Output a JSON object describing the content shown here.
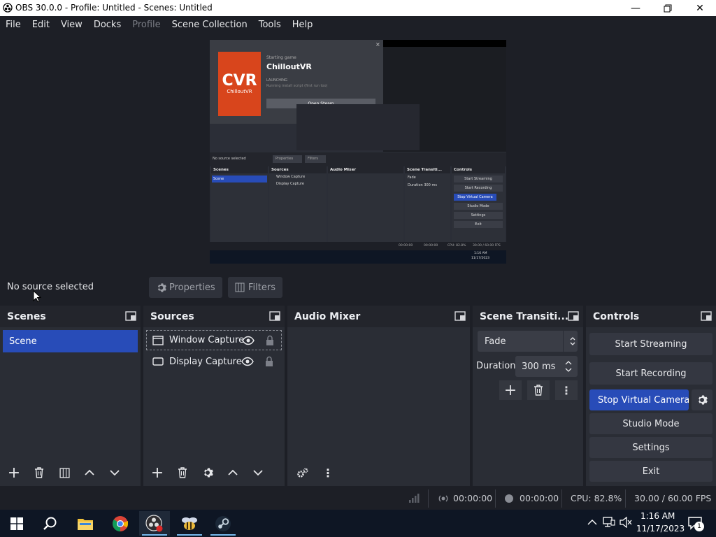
{
  "window": {
    "title": "OBS 30.0.0 - Profile: Untitled - Scenes: Untitled"
  },
  "menu": [
    "File",
    "Edit",
    "View",
    "Docks",
    "Profile",
    "Scene Collection",
    "Tools",
    "Help"
  ],
  "preview": {
    "game_status": "Starting game",
    "game_title": "ChilloutVR",
    "logo_text": "ChilloutVR",
    "launching": "LAUNCHING",
    "launch_note": "Running install script (first run too)",
    "open_steam": "Open Steam",
    "nested_no_source": "No source selected",
    "nested_properties": "Properties",
    "nested_filters": "Filters",
    "nested_docks": [
      "Scenes",
      "Sources",
      "Audio Mixer",
      "Scene Transiti...",
      "Controls"
    ],
    "nested_scene": "Scene",
    "nested_sources": [
      "Window Capture",
      "Display Capture"
    ],
    "nested_fade": "Fade",
    "nested_duration": "Duration",
    "nested_duration_val": "300 ms",
    "nested_controls": [
      "Start Streaming",
      "Start Recording",
      "Stop Virtual Camera",
      "Studio Mode",
      "Settings",
      "Exit"
    ],
    "nested_status": [
      "00:00:00",
      "00:00:00",
      "CPU: 82.8%",
      "30.00 / 60.00 FPS"
    ],
    "nested_time": "1:16 AM",
    "nested_date": "11/17/2023"
  },
  "context": {
    "no_source": "No source selected",
    "properties": "Properties",
    "filters": "Filters"
  },
  "scenes": {
    "title": "Scenes",
    "items": [
      "Scene"
    ]
  },
  "sources": {
    "title": "Sources",
    "items": [
      "Window Capture",
      "Display Capture"
    ]
  },
  "audio": {
    "title": "Audio Mixer"
  },
  "transitions": {
    "title": "Scene Transiti...",
    "selected": "Fade",
    "duration_label": "Duration",
    "duration_value": "300 ms"
  },
  "controls": {
    "title": "Controls",
    "start_streaming": "Start Streaming",
    "start_recording": "Start Recording",
    "stop_virtual_camera": "Stop Virtual Camera",
    "studio_mode": "Studio Mode",
    "settings": "Settings",
    "exit": "Exit"
  },
  "status": {
    "stream_time": "00:00:00",
    "record_time": "00:00:00",
    "cpu": "CPU: 82.8%",
    "fps": "30.00 / 60.00 FPS"
  },
  "taskbar": {
    "time": "1:16 AM",
    "date": "11/17/2023",
    "notifications": "1"
  },
  "colors": {
    "accent": "#284cb8",
    "panel": "#2a2d35",
    "background": "#1d1f26"
  }
}
